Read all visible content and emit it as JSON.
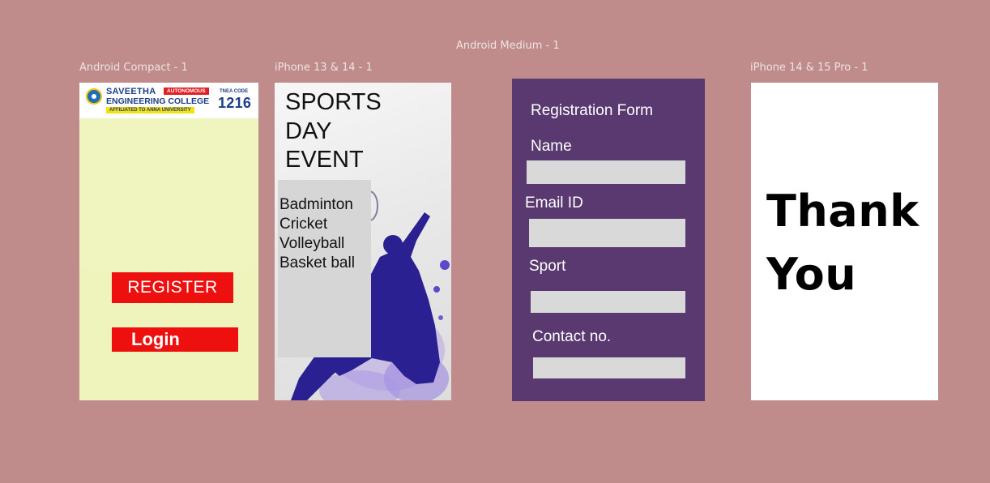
{
  "canvas": {
    "background": "#bf8c8b"
  },
  "frame_labels": {
    "android_compact": "Android Compact - 1",
    "iphone13": "iPhone 13 & 14 - 1",
    "android_medium": "Android Medium - 1",
    "iphone14pro": "iPhone 14 & 15 Pro - 1"
  },
  "welcome": {
    "logo": {
      "line1": "SAVEETHA",
      "line2": "ENGINEERING COLLEGE",
      "autonomous": "AUTONOMOUS",
      "affiliated": "AFFILIATED TO ANNA UNIVERSITY",
      "tnea_label": "TNEA CODE",
      "tnea_code": "1216"
    },
    "register_label": "REGISTER",
    "login_label": "Login",
    "button_color": "#ee0f0f",
    "background": "#f0f5c0"
  },
  "event": {
    "title_lines": [
      "SPORTS",
      "DAY",
      "EVENT"
    ],
    "sports": [
      "Badminton",
      "Cricket",
      "Volleyball",
      "Basket ball"
    ]
  },
  "form": {
    "heading": "Registration Form",
    "name_label": "Name",
    "email_label": "Email ID",
    "sport_label": "Sport",
    "contact_label": "Contact no.",
    "background": "#593970"
  },
  "thanks": {
    "line1": "Thank",
    "line2": "You"
  }
}
